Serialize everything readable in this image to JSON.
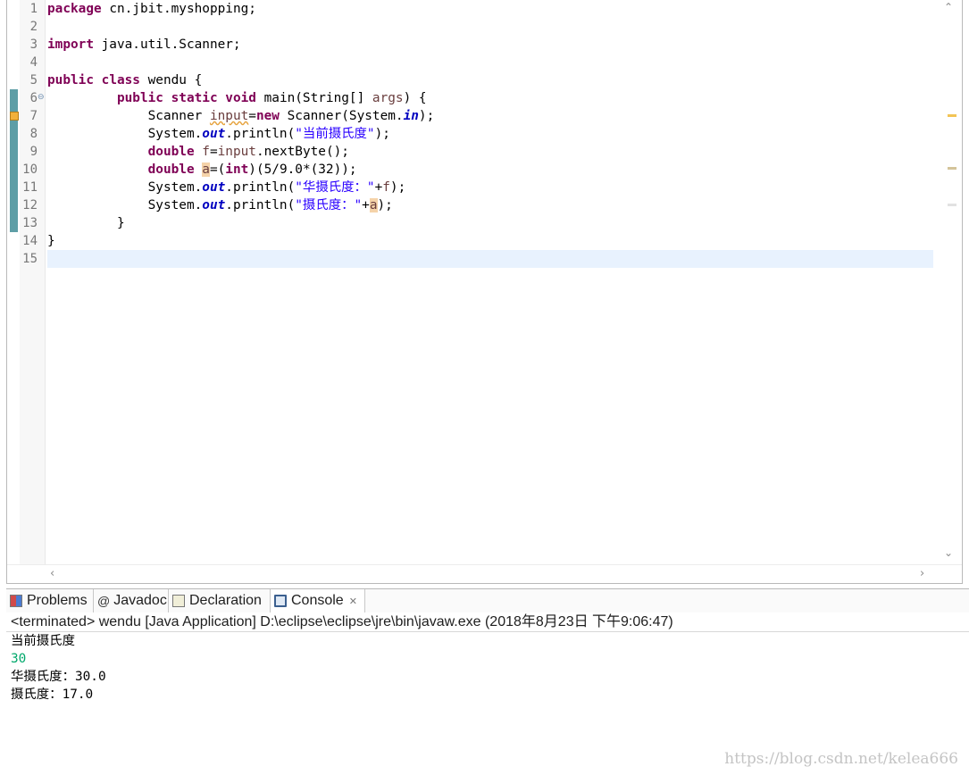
{
  "editor": {
    "line_numbers": [
      "1",
      "2",
      "3",
      "4",
      "5",
      "6",
      "7",
      "8",
      "9",
      "10",
      "11",
      "12",
      "13",
      "14",
      "15"
    ],
    "lines": [
      [
        {
          "t": "package",
          "c": "kw"
        },
        {
          "t": " cn.jbit.myshopping;"
        }
      ],
      [],
      [
        {
          "t": "import",
          "c": "kw"
        },
        {
          "t": " java.util.Scanner;"
        }
      ],
      [],
      [
        {
          "t": "public",
          "c": "kw"
        },
        {
          "t": " "
        },
        {
          "t": "class",
          "c": "kw"
        },
        {
          "t": " wendu {"
        }
      ],
      [
        {
          "t": "         "
        },
        {
          "t": "public",
          "c": "kw"
        },
        {
          "t": " "
        },
        {
          "t": "static",
          "c": "kw"
        },
        {
          "t": " "
        },
        {
          "t": "void",
          "c": "kw"
        },
        {
          "t": " main(String[] "
        },
        {
          "t": "args",
          "c": "var"
        },
        {
          "t": ") {"
        }
      ],
      [
        {
          "t": "             Scanner "
        },
        {
          "t": "input",
          "c": "var squig"
        },
        {
          "t": "="
        },
        {
          "t": "new",
          "c": "kw"
        },
        {
          "t": " Scanner(System."
        },
        {
          "t": "in",
          "c": "fld"
        },
        {
          "t": ");"
        }
      ],
      [
        {
          "t": "             System."
        },
        {
          "t": "out",
          "c": "fld"
        },
        {
          "t": ".println("
        },
        {
          "t": "\"当前摄氏度\"",
          "c": "str"
        },
        {
          "t": ");"
        }
      ],
      [
        {
          "t": "             "
        },
        {
          "t": "double",
          "c": "kw"
        },
        {
          "t": " "
        },
        {
          "t": "f",
          "c": "var"
        },
        {
          "t": "="
        },
        {
          "t": "input",
          "c": "var"
        },
        {
          "t": ".nextByte();"
        }
      ],
      [
        {
          "t": "             "
        },
        {
          "t": "double",
          "c": "kw"
        },
        {
          "t": " "
        },
        {
          "t": "a",
          "c": "var occ"
        },
        {
          "t": "=("
        },
        {
          "t": "int",
          "c": "kw"
        },
        {
          "t": ")(5/9.0*(32));"
        }
      ],
      [
        {
          "t": "             System."
        },
        {
          "t": "out",
          "c": "fld"
        },
        {
          "t": ".println("
        },
        {
          "t": "\"华摄氏度：\"",
          "c": "str"
        },
        {
          "t": "+"
        },
        {
          "t": "f",
          "c": "var"
        },
        {
          "t": ");"
        }
      ],
      [
        {
          "t": "             System."
        },
        {
          "t": "out",
          "c": "fld"
        },
        {
          "t": ".println("
        },
        {
          "t": "\"摄氏度：\"",
          "c": "str"
        },
        {
          "t": "+"
        },
        {
          "t": "a",
          "c": "var occ"
        },
        {
          "t": ");"
        }
      ],
      [
        {
          "t": "         }"
        }
      ],
      [
        {
          "t": "}"
        }
      ],
      []
    ]
  },
  "views": {
    "tabs": [
      {
        "label": "Problems",
        "icon": "problems-icon"
      },
      {
        "label": "Javadoc",
        "icon": "at-icon"
      },
      {
        "label": "Declaration",
        "icon": "declaration-icon"
      },
      {
        "label": "Console",
        "icon": "console-icon"
      }
    ],
    "active_tab": "Console",
    "close_glyph": "✕"
  },
  "console": {
    "description": "<terminated> wendu [Java Application] D:\\eclipse\\eclipse\\jre\\bin\\javaw.exe (2018年8月23日 下午9:06:47)",
    "output": [
      {
        "text": "当前摄氏度",
        "kind": "stdout"
      },
      {
        "text": "30",
        "kind": "stdin"
      },
      {
        "text": "华摄氏度：30.0",
        "kind": "stdout"
      },
      {
        "text": "摄氏度：17.0",
        "kind": "stdout"
      }
    ]
  },
  "watermark": "https://blog.csdn.net/kelea666",
  "colors": {
    "keyword": "#7f0055",
    "string": "#2a00ff",
    "field": "#0000c0",
    "local_variable": "#6a3e3e",
    "current_line": "#e8f2fe",
    "console_input": "#00a86b",
    "change_bar": "#5e9ea6",
    "warning": "#f2b13b"
  }
}
